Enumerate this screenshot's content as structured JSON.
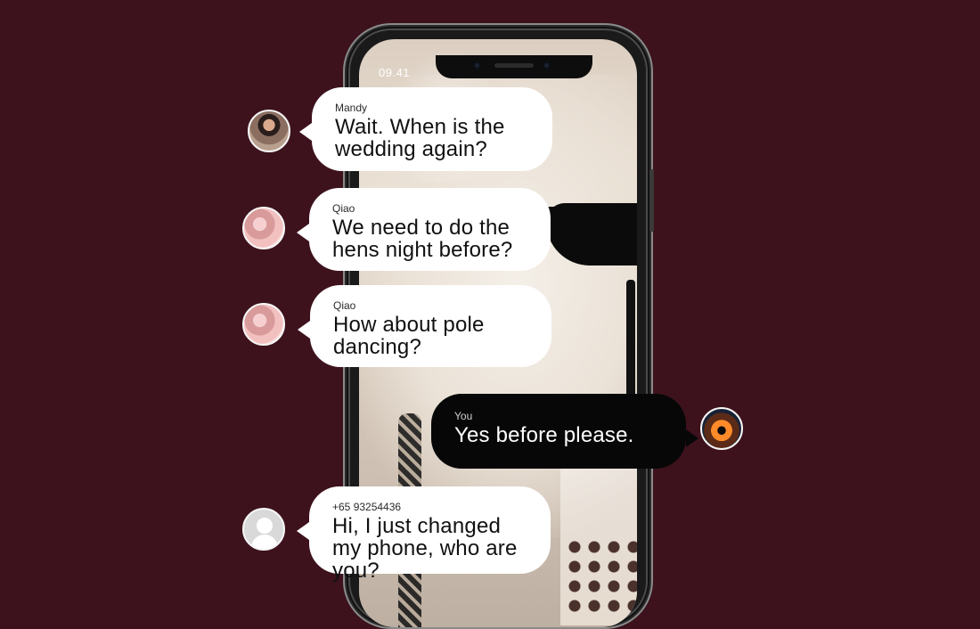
{
  "theme": {
    "background": "#3d121d"
  },
  "status_bar": {
    "time": "09.41"
  },
  "messages": [
    {
      "sender": "Mandy",
      "text": "Wait. When is the wedding again?",
      "avatar": "avatar-mandy"
    },
    {
      "sender": "Qiao",
      "text": "We need to do the hens night before?",
      "avatar": "avatar-qiao"
    },
    {
      "sender": "Qiao",
      "text": "How about pole dancing?",
      "avatar": "avatar-qiao"
    },
    {
      "sender": "You",
      "text": "Yes before please.",
      "avatar": "avatar-you"
    },
    {
      "sender": "+65 93254436",
      "text": "Hi, I just changed my phone, who are you?",
      "avatar": "avatar-unknown"
    }
  ]
}
